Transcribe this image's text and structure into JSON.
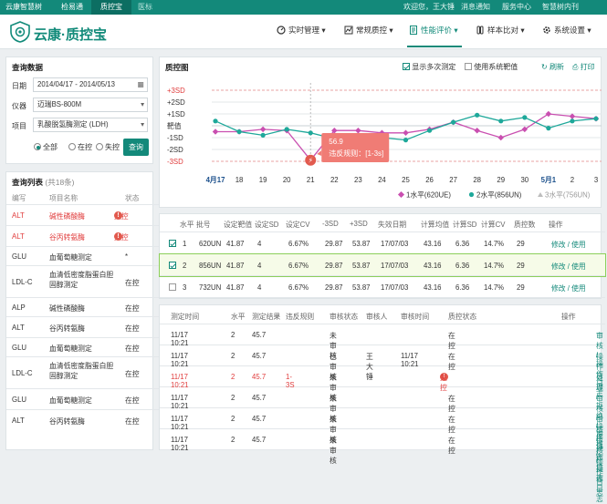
{
  "topbar": {
    "tabs": [
      "云康智慧树",
      "检易通",
      "质控宝",
      "医标"
    ],
    "right": [
      "欢迎您，王大锤",
      "消息通知",
      "服务中心",
      "智慧树内刊"
    ]
  },
  "header": {
    "brand": "云康·质控宝",
    "nav": [
      "实时管理",
      "常规质控",
      "性能评价",
      "样本比对",
      "系统设置"
    ]
  },
  "query": {
    "title": "查询数据",
    "date_label": "日期",
    "date_value": "2014/04/17 - 2014/05/13",
    "instrument_label": "仪器",
    "instrument_value": "迈瑞BS-800M",
    "item_label": "项目",
    "item_value": "乳酸脱氢酶测定 (LDH)",
    "radios": [
      "全部",
      "在控",
      "失控"
    ],
    "button": "查询"
  },
  "list": {
    "title": "查询列表",
    "count": "(共18条)",
    "headers": [
      "编写",
      "项目名称",
      "状态"
    ],
    "rows": [
      {
        "code": "ALT",
        "name": "碱性磷酸酶",
        "status": "失控",
        "alert": true
      },
      {
        "code": "ALT",
        "name": "谷丙转氨酶",
        "status": "失控",
        "alert": true
      },
      {
        "code": "GLU",
        "name": "血葡萄糖测定",
        "status": "*",
        "alert": false
      },
      {
        "code": "LDL-C",
        "name": "血清低密度脂蛋白胆固醇测定",
        "status": "在控",
        "alert": false
      },
      {
        "code": "ALP",
        "name": "碱性磷酸酶",
        "status": "在控",
        "alert": false
      },
      {
        "code": "ALT",
        "name": "谷丙转氨酶",
        "status": "在控",
        "alert": false
      },
      {
        "code": "GLU",
        "name": "血葡萄糖测定",
        "status": "在控",
        "alert": false
      },
      {
        "code": "LDL-C",
        "name": "血清低密度脂蛋白胆固醇测定",
        "status": "在控",
        "alert": false
      },
      {
        "code": "GLU",
        "name": "血葡萄糖测定",
        "status": "在控",
        "alert": false
      },
      {
        "code": "ALT",
        "name": "谷丙转氨酶",
        "status": "在控",
        "alert": false
      }
    ]
  },
  "chart": {
    "title": "质控图",
    "opt1": "显示多次测定",
    "opt2": "使用系统靶值",
    "refresh": "刷新",
    "print": "打印",
    "tooltip_value": "56.9",
    "tooltip_rule": "违反规则：[1-3s]"
  },
  "chart_data": {
    "type": "line",
    "y_ticks": [
      "+3SD",
      "+2SD",
      "+1SD",
      "靶值",
      "-1SD",
      "-2SD",
      "-3SD"
    ],
    "x_ticks": [
      "4月17",
      "18",
      "19",
      "20",
      "21",
      "22",
      "23",
      "24",
      "25",
      "26",
      "27",
      "28",
      "29",
      "30",
      "5月1",
      "2",
      "3"
    ],
    "series": [
      {
        "name": "1水平(620UE)",
        "color": "#c94fb0",
        "values": [
          -0.5,
          -0.5,
          -0.3,
          -0.4,
          -2.9,
          -0.4,
          -0.4,
          -0.6,
          -0.6,
          -0.3,
          0.3,
          -0.4,
          -1.0,
          -0.3,
          1.0,
          0.8,
          0.6
        ]
      },
      {
        "name": "2水平(856UN)",
        "color": "#1ea89a",
        "values": [
          0.4,
          -0.5,
          -0.8,
          -0.3,
          -0.6,
          -1.1,
          -1.3,
          -1.0,
          -1.2,
          -0.4,
          0.3,
          0.9,
          0.4,
          0.7,
          -0.2,
          0.4,
          0.6
        ]
      },
      {
        "name": "3水平(756UN)",
        "color": "#bdbdbd",
        "values": []
      }
    ]
  },
  "levels": {
    "headers": [
      "水平",
      "批号",
      "设定靶值",
      "设定SD",
      "设定CV",
      "-3SD",
      "+3SD",
      "失效日期",
      "计算均值",
      "计算SD",
      "计算CV",
      "质控数",
      "操作"
    ],
    "rows": [
      {
        "checked": true,
        "level": "1",
        "lot": "620UN",
        "target": "41.87",
        "sd": "4",
        "cv": "6.67%",
        "m3": "29.87",
        "p3": "53.87",
        "exp": "17/07/03",
        "mean": "43.16",
        "csd": "6.36",
        "ccv": "14.7%",
        "n": "29",
        "op": "修改 / 使用"
      },
      {
        "checked": true,
        "level": "2",
        "lot": "856UN",
        "target": "41.87",
        "sd": "4",
        "cv": "6.67%",
        "m3": "29.87",
        "p3": "53.87",
        "exp": "17/07/03",
        "mean": "43.16",
        "csd": "6.36",
        "ccv": "14.7%",
        "n": "29",
        "op": "修改 / 使用"
      },
      {
        "checked": false,
        "level": "3",
        "lot": "732UN",
        "target": "41.87",
        "sd": "4",
        "cv": "6.67%",
        "m3": "29.87",
        "p3": "53.87",
        "exp": "17/07/03",
        "mean": "43.16",
        "csd": "6.36",
        "ccv": "14.7%",
        "n": "29",
        "op": "修改 / 使用"
      }
    ]
  },
  "records": {
    "headers": [
      "测定时间",
      "水平",
      "测定结果",
      "违反规则",
      "审核状态",
      "审核人",
      "审核时间",
      "质控状态",
      "操作"
    ],
    "rows": [
      {
        "time": "11/17 10:21",
        "level": "2",
        "result": "45.7",
        "rule": "",
        "audit": "未审核",
        "auditor": "",
        "atime": "",
        "state": "在控",
        "op": "审核 / 操作日志",
        "bad": false
      },
      {
        "time": "11/17 10:21",
        "level": "2",
        "result": "45.7",
        "rule": "",
        "audit": "已审核",
        "auditor": "王大锤",
        "atime": "11/17 10:21",
        "state": "在控",
        "op": "操作日志",
        "bad": false
      },
      {
        "time": "11/17 10:21",
        "level": "2",
        "result": "45.7",
        "rule": "1-3S",
        "audit": "未审核",
        "auditor": "",
        "atime": "",
        "state": "失控",
        "op": "处理 / 拒绝 / 审核 / 操作日志",
        "bad": true
      },
      {
        "time": "11/17 10:21",
        "level": "2",
        "result": "45.7",
        "rule": "",
        "audit": "未审核",
        "auditor": "",
        "atime": "",
        "state": "在控",
        "op": "审核 / 操作日志",
        "bad": false
      },
      {
        "time": "11/17 10:21",
        "level": "2",
        "result": "45.7",
        "rule": "",
        "audit": "未审核",
        "auditor": "",
        "atime": "",
        "state": "在控",
        "op": "审核 / 操作日志",
        "bad": false
      },
      {
        "time": "11/17 10:21",
        "level": "2",
        "result": "45.7",
        "rule": "",
        "audit": "未审核",
        "auditor": "",
        "atime": "",
        "state": "在控",
        "op": "审核 / 操作日志",
        "bad": false
      }
    ]
  }
}
